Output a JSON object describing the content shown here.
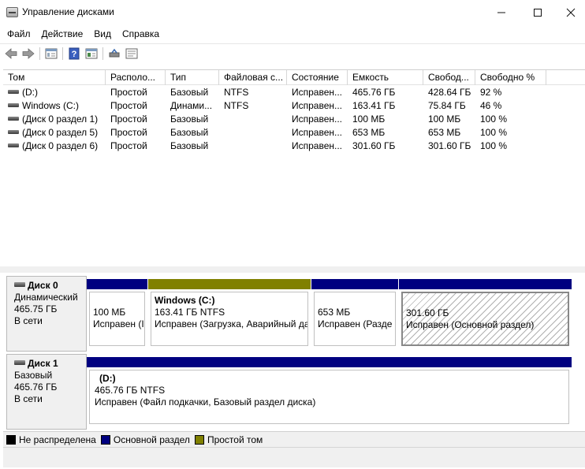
{
  "window": {
    "title": "Управление дисками",
    "minimize_glyph": "—",
    "maximize_glyph": "☐",
    "close_glyph": "✕"
  },
  "menu": [
    "Файл",
    "Действие",
    "Вид",
    "Справка"
  ],
  "toolbar": [
    "back-icon",
    "forward-icon",
    "console-tree-icon",
    "help-icon",
    "properties-icon",
    "connect-icon",
    "console-icon"
  ],
  "columns": [
    "Том",
    "Располо...",
    "Тип",
    "Файловая с...",
    "Состояние",
    "Емкость",
    "Свобод...",
    "Свободно %"
  ],
  "volumes": [
    {
      "name": "(D:)",
      "layout": "Простой",
      "type": "Базовый",
      "fs": "NTFS",
      "status": "Исправен...",
      "capacity": "465.76 ГБ",
      "free": "428.64 ГБ",
      "free_pct": "92 %"
    },
    {
      "name": "Windows (C:)",
      "layout": "Простой",
      "type": "Динами...",
      "fs": "NTFS",
      "status": "Исправен...",
      "capacity": "163.41 ГБ",
      "free": "75.84 ГБ",
      "free_pct": "46 %"
    },
    {
      "name": "(Диск 0 раздел 1)",
      "layout": "Простой",
      "type": "Базовый",
      "fs": "",
      "status": "Исправен...",
      "capacity": "100 МБ",
      "free": "100 МБ",
      "free_pct": "100 %"
    },
    {
      "name": "(Диск 0 раздел 5)",
      "layout": "Простой",
      "type": "Базовый",
      "fs": "",
      "status": "Исправен...",
      "capacity": "653 МБ",
      "free": "653 МБ",
      "free_pct": "100 %"
    },
    {
      "name": "(Диск 0 раздел 6)",
      "layout": "Простой",
      "type": "Базовый",
      "fs": "",
      "status": "Исправен...",
      "capacity": "301.60 ГБ",
      "free": "301.60 ГБ",
      "free_pct": "100 %"
    }
  ],
  "disks": [
    {
      "name": "Диск 0",
      "type": "Динамический",
      "size": "465.75 ГБ",
      "state": "В сети",
      "partitions": [
        {
          "title": "",
          "line1": "100 МБ",
          "line2": "Исправен (I"
        },
        {
          "title": "Windows  (C:)",
          "line1": "163.41 ГБ NTFS",
          "line2": "Исправен (Загрузка, Аварийный да"
        },
        {
          "title": "",
          "line1": "653 МБ",
          "line2": "Исправен (Разде"
        },
        {
          "title": "",
          "line1": "301.60 ГБ",
          "line2": "Исправен (Основной раздел)"
        }
      ]
    },
    {
      "name": "Диск 1",
      "type": "Базовый",
      "size": "465.76 ГБ",
      "state": "В сети",
      "partitions": [
        {
          "title": "(D:)",
          "line1": "465.76 ГБ NTFS",
          "line2": "Исправен (Файл подкачки, Базовый раздел диска)"
        }
      ]
    }
  ],
  "legend": [
    {
      "label": "Не распределена",
      "color": "#000000"
    },
    {
      "label": "Основной раздел",
      "color": "#000080"
    },
    {
      "label": "Простой том",
      "color": "#808000"
    }
  ],
  "colors": {
    "primary": "#000080",
    "simple": "#808000",
    "unallocated": "#000000"
  }
}
